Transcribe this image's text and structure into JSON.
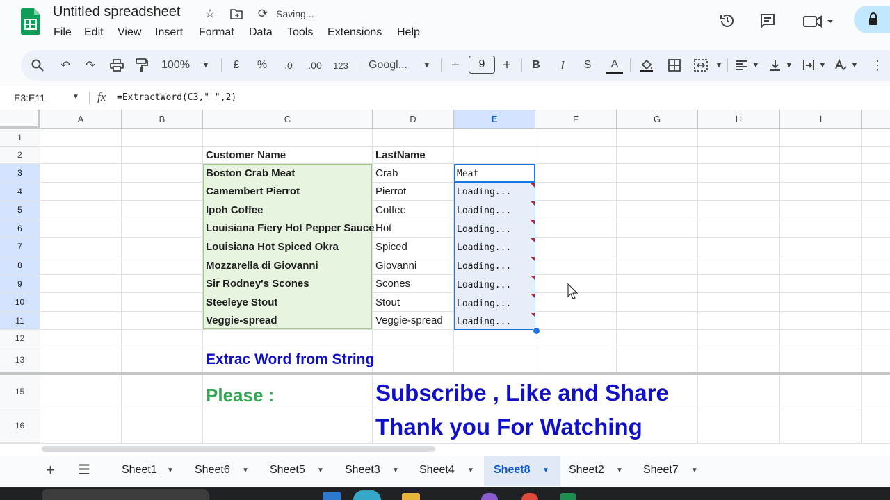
{
  "app": {
    "title": "Untitled spreadsheet",
    "status": "Saving...",
    "menu": [
      "File",
      "Edit",
      "View",
      "Insert",
      "Format",
      "Data",
      "Tools",
      "Extensions",
      "Help"
    ]
  },
  "toolbar": {
    "zoom": "100%",
    "currency": "£",
    "percent": "%",
    "dec_decrease": ".0",
    "dec_increase": ".00",
    "format_num": "123",
    "font": "Googl...",
    "font_size": "9",
    "minus": "−",
    "plus": "+",
    "bold": "B",
    "italic": "I",
    "strike": "S",
    "text_color": "A"
  },
  "formula_bar": {
    "name_box": "E3:E11",
    "fx": "fx",
    "formula": "=ExtractWord(C3,\" \",2)"
  },
  "columns": [
    "A",
    "B",
    "C",
    "D",
    "E",
    "F",
    "G",
    "H",
    "I"
  ],
  "rows": [
    "1",
    "2",
    "3",
    "4",
    "5",
    "6",
    "7",
    "8",
    "9",
    "10",
    "11",
    "12",
    "13",
    "15",
    "16"
  ],
  "table": {
    "header_c": "Customer Name",
    "header_d": "LastName",
    "customers": [
      "Boston Crab Meat",
      "Camembert Pierrot",
      "Ipoh Coffee",
      "Louisiana Fiery Hot Pepper Sauce",
      "Louisiana Hot Spiced Okra",
      "Mozzarella di Giovanni",
      "Sir Rodney's Scones",
      "Steeleye Stout",
      "Veggie-spread"
    ],
    "last_names": [
      "Crab",
      "Pierrot",
      "Coffee",
      "Hot",
      "Spiced",
      "Giovanni",
      "Scones",
      "Stout",
      "Veggie-spread"
    ],
    "results": [
      "Meat",
      "Loading...",
      "Loading...",
      "Loading...",
      "Loading...",
      "Loading...",
      "Loading...",
      "Loading...",
      "Loading..."
    ]
  },
  "notes": {
    "heading": "Extrac Word from String",
    "please": "Please :",
    "subscribe": "Subscribe , Like and Share",
    "thanks": "Thank you For Watching"
  },
  "sheets": [
    "Sheet1",
    "Sheet6",
    "Sheet5",
    "Sheet3",
    "Sheet4",
    "Sheet8",
    "Sheet2",
    "Sheet7"
  ],
  "active_sheet": "Sheet8",
  "colors": {
    "accent": "#0b57d0",
    "green_fill": "#e6f4e0",
    "blue_text": "#1010c8",
    "green_text": "#34a853"
  }
}
